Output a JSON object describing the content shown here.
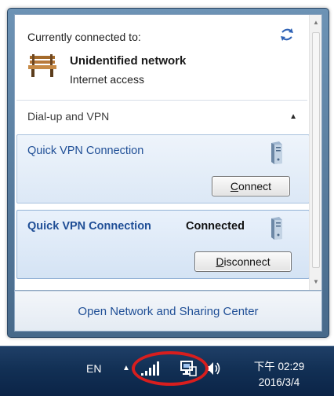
{
  "connected": {
    "heading": "Currently connected to:",
    "network_name": "Unidentified network",
    "network_status": "Internet access",
    "icons": {
      "refresh": "refresh-arrows-icon",
      "network": "bench-icon"
    }
  },
  "dialup": {
    "label": "Dial-up and VPN",
    "chevron": "˄"
  },
  "vpns": [
    {
      "name": "Quick VPN Connection",
      "status": "",
      "button_pre": "",
      "button_u": "C",
      "button_post": "onnect"
    },
    {
      "name": "Quick VPN Connection",
      "status": "Connected",
      "button_pre": "",
      "button_u": "D",
      "button_post": "isconnect"
    }
  ],
  "footer": {
    "link": "Open Network and Sharing Center"
  },
  "taskbar": {
    "language": "EN",
    "expand": "▲",
    "clock_time": "下午 02:29",
    "clock_date": "2016/3/4",
    "icons": [
      "signal-bars-icon",
      "network-monitor-icon",
      "volume-icon"
    ]
  },
  "colors": {
    "link": "#1f4e96",
    "taskbar": "#123055",
    "highlight": "#d81e1e"
  }
}
